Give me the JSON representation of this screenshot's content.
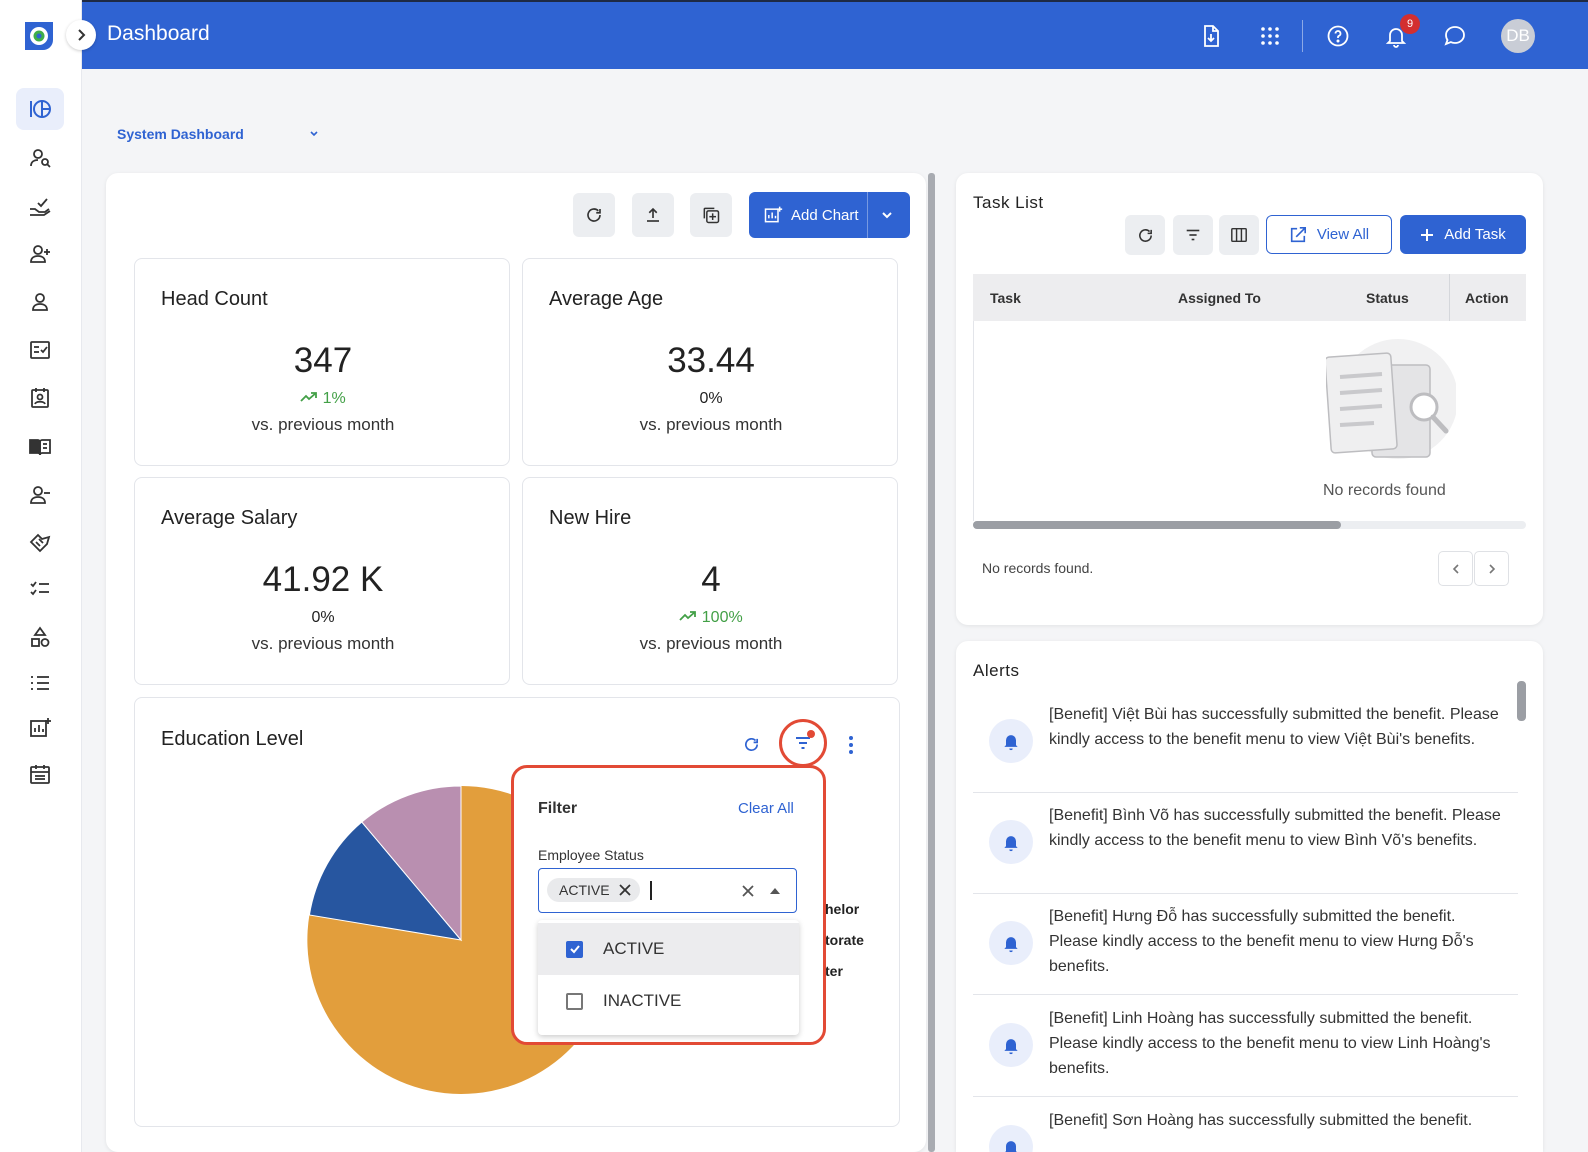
{
  "header": {
    "title": "Dashboard",
    "notification_count": "9",
    "avatar_initials": "DB"
  },
  "dashboard_selector": {
    "selected": "System Dashboard"
  },
  "toolbar": {
    "add_chart_label": "Add Chart"
  },
  "kpis": [
    {
      "title": "Head Count",
      "value": "347",
      "change": "1%",
      "trend": "up",
      "sub": "vs. previous month"
    },
    {
      "title": "Average Age",
      "value": "33.44",
      "change": "0%",
      "trend": "flat",
      "sub": "vs. previous month"
    },
    {
      "title": "Average Salary",
      "value": "41.92 K",
      "change": "0%",
      "trend": "flat",
      "sub": "vs. previous month"
    },
    {
      "title": "New Hire",
      "value": "4",
      "change": "100%",
      "trend": "up",
      "sub": "vs. previous month"
    }
  ],
  "education": {
    "title": "Education Level",
    "legend_visible": [
      "helor",
      "torate",
      "ter"
    ],
    "colors": [
      "#e29e3c",
      "#2756a0",
      "#b98fb0"
    ]
  },
  "filter": {
    "title": "Filter",
    "clear_all": "Clear All",
    "field_label": "Employee Status",
    "chip": "ACTIVE",
    "options": [
      {
        "label": "ACTIVE",
        "checked": true
      },
      {
        "label": "INACTIVE",
        "checked": false
      }
    ]
  },
  "task_list": {
    "title": "Task List",
    "view_all": "View All",
    "add_task": "Add Task",
    "columns": [
      "Task",
      "Assigned To",
      "Status",
      "Action"
    ],
    "empty": "No records found",
    "footer": "No records found."
  },
  "alerts": {
    "title": "Alerts",
    "items": [
      "[Benefit] Việt Bùi has successfully submitted the benefit. Please kindly access to the benefit menu to view Việt Bùi's benefits.",
      "[Benefit] Bình Võ has successfully submitted the benefit. Please kindly access to the benefit menu to view Bình Võ's benefits.",
      "[Benefit] Hưng Đỗ has successfully submitted the benefit. Please kindly access to the benefit menu to view Hưng Đỗ's benefits.",
      "[Benefit] Linh Hoàng has successfully submitted the benefit. Please kindly access to the benefit menu to view Linh Hoàng's benefits.",
      "[Benefit] Sơn Hoàng has successfully submitted the benefit."
    ]
  },
  "colors": {
    "brand": "#2f63d2",
    "highlight": "#e24a35",
    "positive": "#43a047"
  }
}
